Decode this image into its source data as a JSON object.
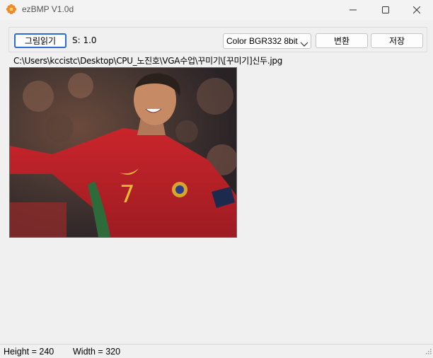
{
  "window": {
    "title": "ezBMP V1.0d",
    "icon": "app-flower-icon",
    "controls": [
      "minimize-icon",
      "maximize-icon",
      "close-icon"
    ]
  },
  "toolbar": {
    "load_label": "그림읽기",
    "scale_text": "S: 1.0",
    "color_mode": {
      "selected": "Color BGR332 8bit"
    },
    "convert_label": "변환",
    "save_label": "저장"
  },
  "file_path": "C:\\Users\\kccistc\\Desktop\\CPU_노진호\\VGA수업\\꾸미기\\[꾸미기]신두.jpg",
  "image": {
    "description_icon": "loaded-photo",
    "height": 240,
    "width": 320
  },
  "status": {
    "height_text": "Height = 240",
    "width_text": "Width = 320"
  },
  "colors": {
    "accent": "#2d6bd6",
    "background": "#f0f0f0",
    "icon_orange": "#f08a24"
  }
}
